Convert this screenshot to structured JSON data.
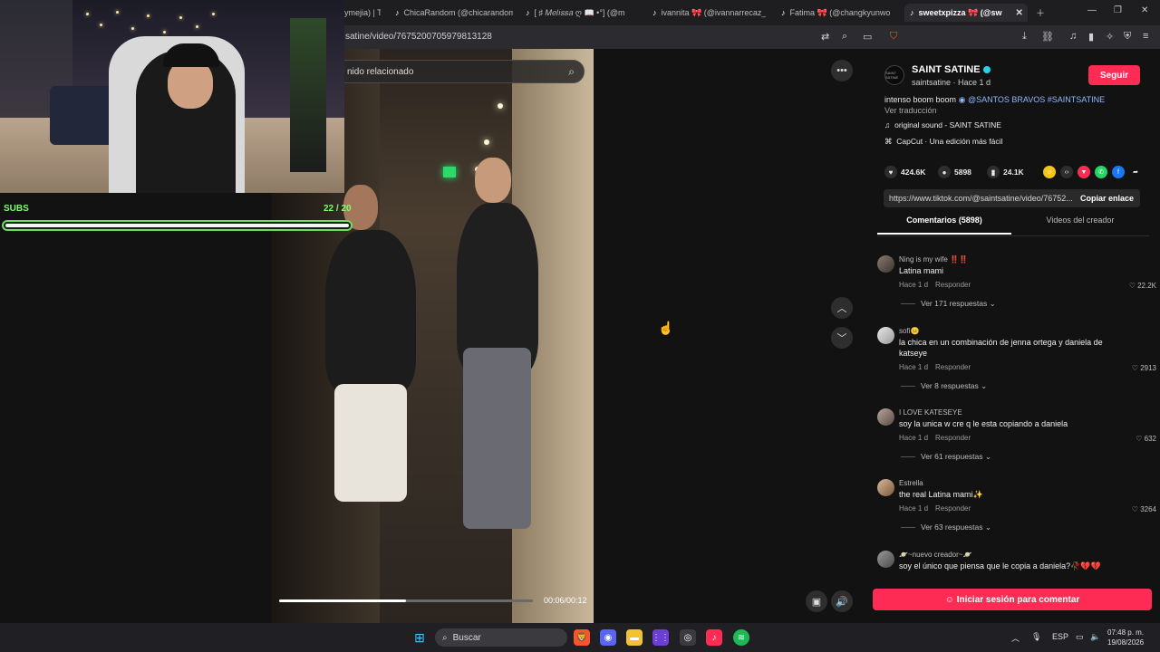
{
  "browser": {
    "tabs": [
      {
        "label": "ymejia) | T"
      },
      {
        "label": "ChicaRandom (@chicarandom"
      },
      {
        "label": "[ ♯ 𝑀𝑒𝑙𝑖𝑠𝑠𝑎 ღ 📖 •°] (@m"
      },
      {
        "label": "ivannita 🎀 (@ivannarrecaz_) |"
      },
      {
        "label": "Fatima 🎀 (@changkyunwo"
      },
      {
        "label": "sweetxpizza 🎀 (@sw"
      }
    ],
    "url": "satine/video/7675200705979813128"
  },
  "video": {
    "search_placeholder": "nido relacionado",
    "progress": 0.5,
    "time": "00:06/00:12"
  },
  "overlay": {
    "subs_label": "SUBS",
    "subs_count": "22 / 20",
    "subs_progress": 1.0
  },
  "creator": {
    "name": "SAINT SATINE",
    "meta": "saintsatine · Hace 1 d",
    "follow": "Seguir",
    "avatar_text": "SAINT SATINE",
    "desc_text": "intenso boom boom",
    "desc_tags": "@SANTOS BRAVOS #SAINTSATINE",
    "translate": "Ver traducción",
    "sound": "original sound - SAINT SATINE",
    "capcut": "CapCut · Una edición más fácil"
  },
  "stats": {
    "likes": "424.6K",
    "comments": "5898",
    "saves": "24.1K"
  },
  "link": {
    "url": "https://www.tiktok.com/@saintsatine/video/76752...",
    "copy": "Copiar enlace"
  },
  "tabs": {
    "comments": "Comentarios (5898)",
    "videos": "Videos del creador"
  },
  "comments": [
    {
      "user": "Ning is my wife ‼️‼️",
      "text": "Latina mami",
      "time": "Hace 1 d",
      "reply": "Responder",
      "likes": "22.2K",
      "more": "Ver 171 respuestas"
    },
    {
      "user": "sofi😐",
      "text": "la chica en un combinación de jenna ortega y daniela de katseye",
      "time": "Hace 1 d",
      "reply": "Responder",
      "likes": "2913",
      "more": "Ver 8 respuestas"
    },
    {
      "user": "I LOVE KATESEYE",
      "text": "soy la unica w cre q le esta copiando a daniela",
      "time": "Hace 1 d",
      "reply": "Responder",
      "likes": "632",
      "more": "Ver 61 respuestas"
    },
    {
      "user": "Estrella",
      "text": "the real Latina mami✨",
      "time": "Hace 1 d",
      "reply": "Responder",
      "likes": "3264",
      "more": "Ver 63 respuestas"
    },
    {
      "user": "🪐~nuevo creador~🪐",
      "text": "soy el único que piensa que le copia a daniela?🥀💔💔",
      "time": "",
      "reply": "",
      "likes": "",
      "more": ""
    }
  ],
  "login_button": "Iniciar sesión para comentar",
  "taskbar": {
    "search": "Buscar",
    "lang": "ESP",
    "time": "07:48 p. m.",
    "date": "19/08/2026"
  },
  "colors": {
    "accent": "#fe2c55",
    "subs_green": "#7dff6b",
    "tag_blue": "#8fb8ff"
  }
}
